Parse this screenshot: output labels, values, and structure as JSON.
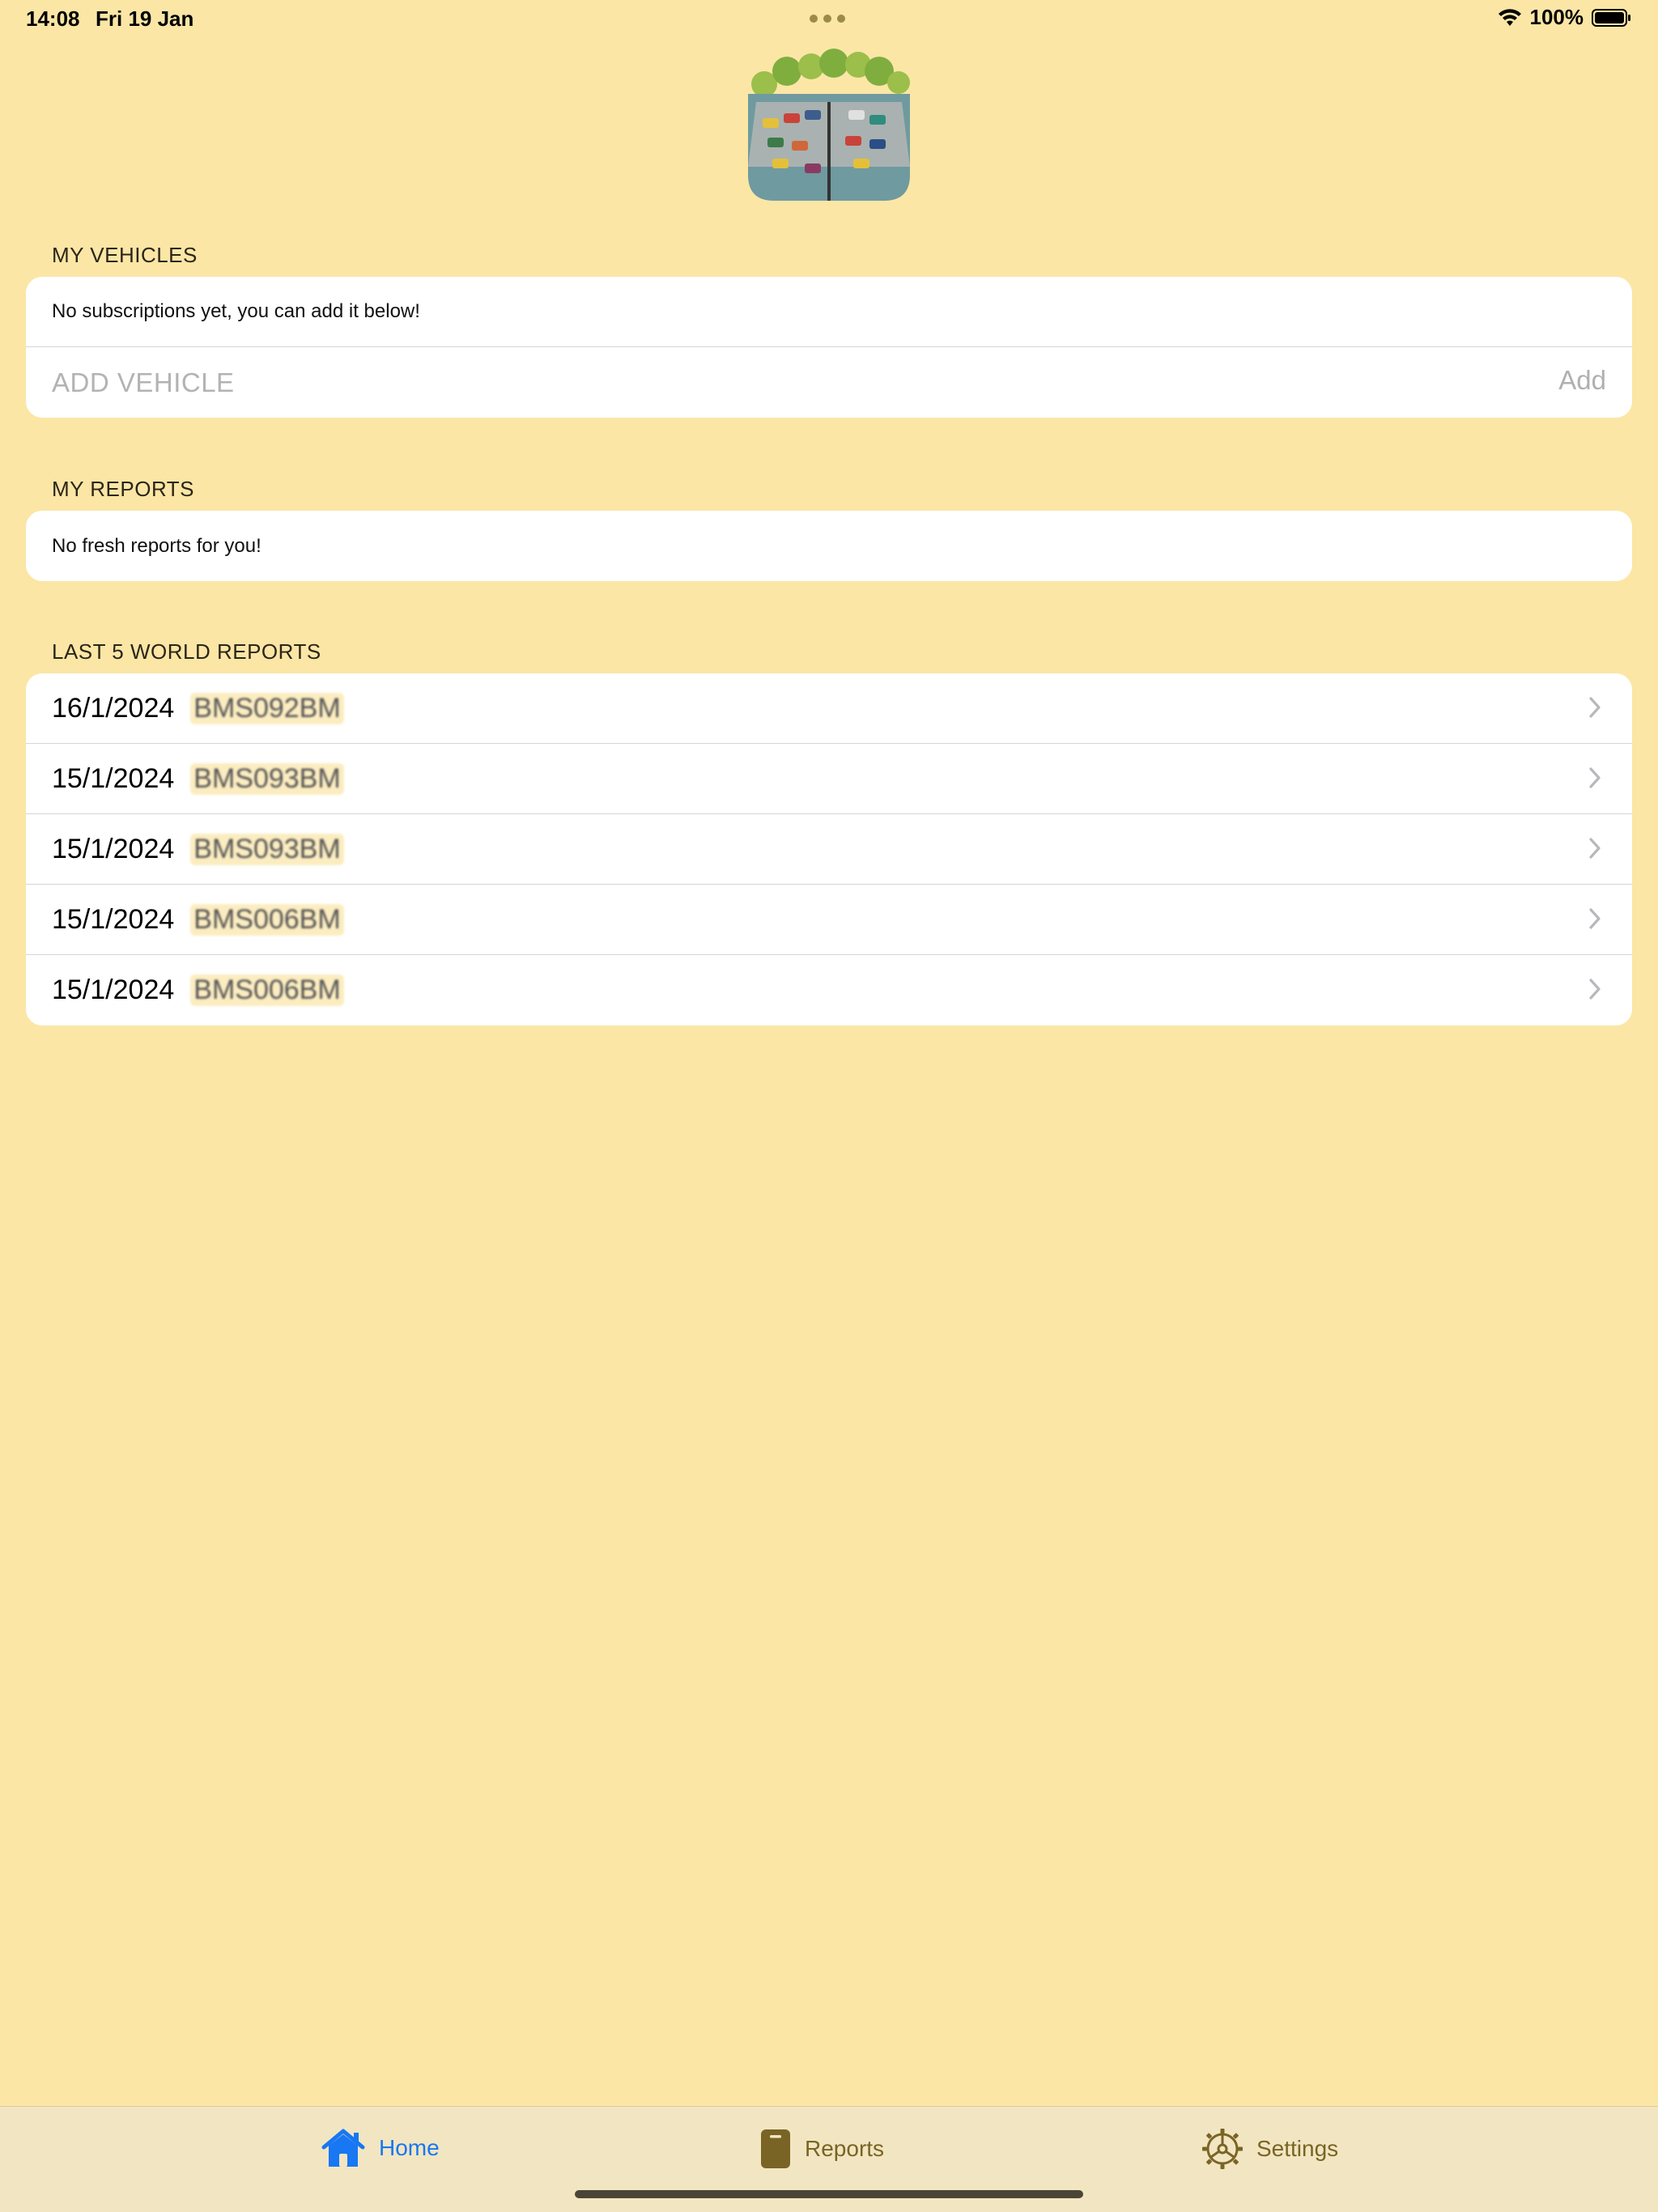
{
  "status_bar": {
    "time": "14:08",
    "date": "Fri 19 Jan",
    "battery": "100%"
  },
  "app": {
    "logo_icon": "parking-lot-illustration"
  },
  "my_vehicles": {
    "header": "MY VEHICLES",
    "empty_message": "No subscriptions yet, you can add it below!",
    "input_placeholder": "ADD VEHICLE",
    "add_label": "Add"
  },
  "my_reports": {
    "header": "MY REPORTS",
    "empty_message": "No fresh reports for you!"
  },
  "world_reports": {
    "header": "LAST 5 WORLD REPORTS",
    "items": [
      {
        "date": "16/1/2024",
        "plate": "BMS092BM"
      },
      {
        "date": "15/1/2024",
        "plate": "BMS093BM"
      },
      {
        "date": "15/1/2024",
        "plate": "BMS093BM"
      },
      {
        "date": "15/1/2024",
        "plate": "BMS006BM"
      },
      {
        "date": "15/1/2024",
        "plate": "BMS006BM"
      }
    ]
  },
  "tab_bar": {
    "tabs": [
      {
        "label": "Home",
        "icon": "house-icon",
        "selected": true
      },
      {
        "label": "Reports",
        "icon": "clipboard-icon",
        "selected": false
      },
      {
        "label": "Settings",
        "icon": "gear-icon",
        "selected": false
      }
    ]
  },
  "colors": {
    "background": "#FBE6A6",
    "tab_bar": "#F2E6C2",
    "accent": "#1877F2",
    "tab_inactive": "#7A6425"
  }
}
